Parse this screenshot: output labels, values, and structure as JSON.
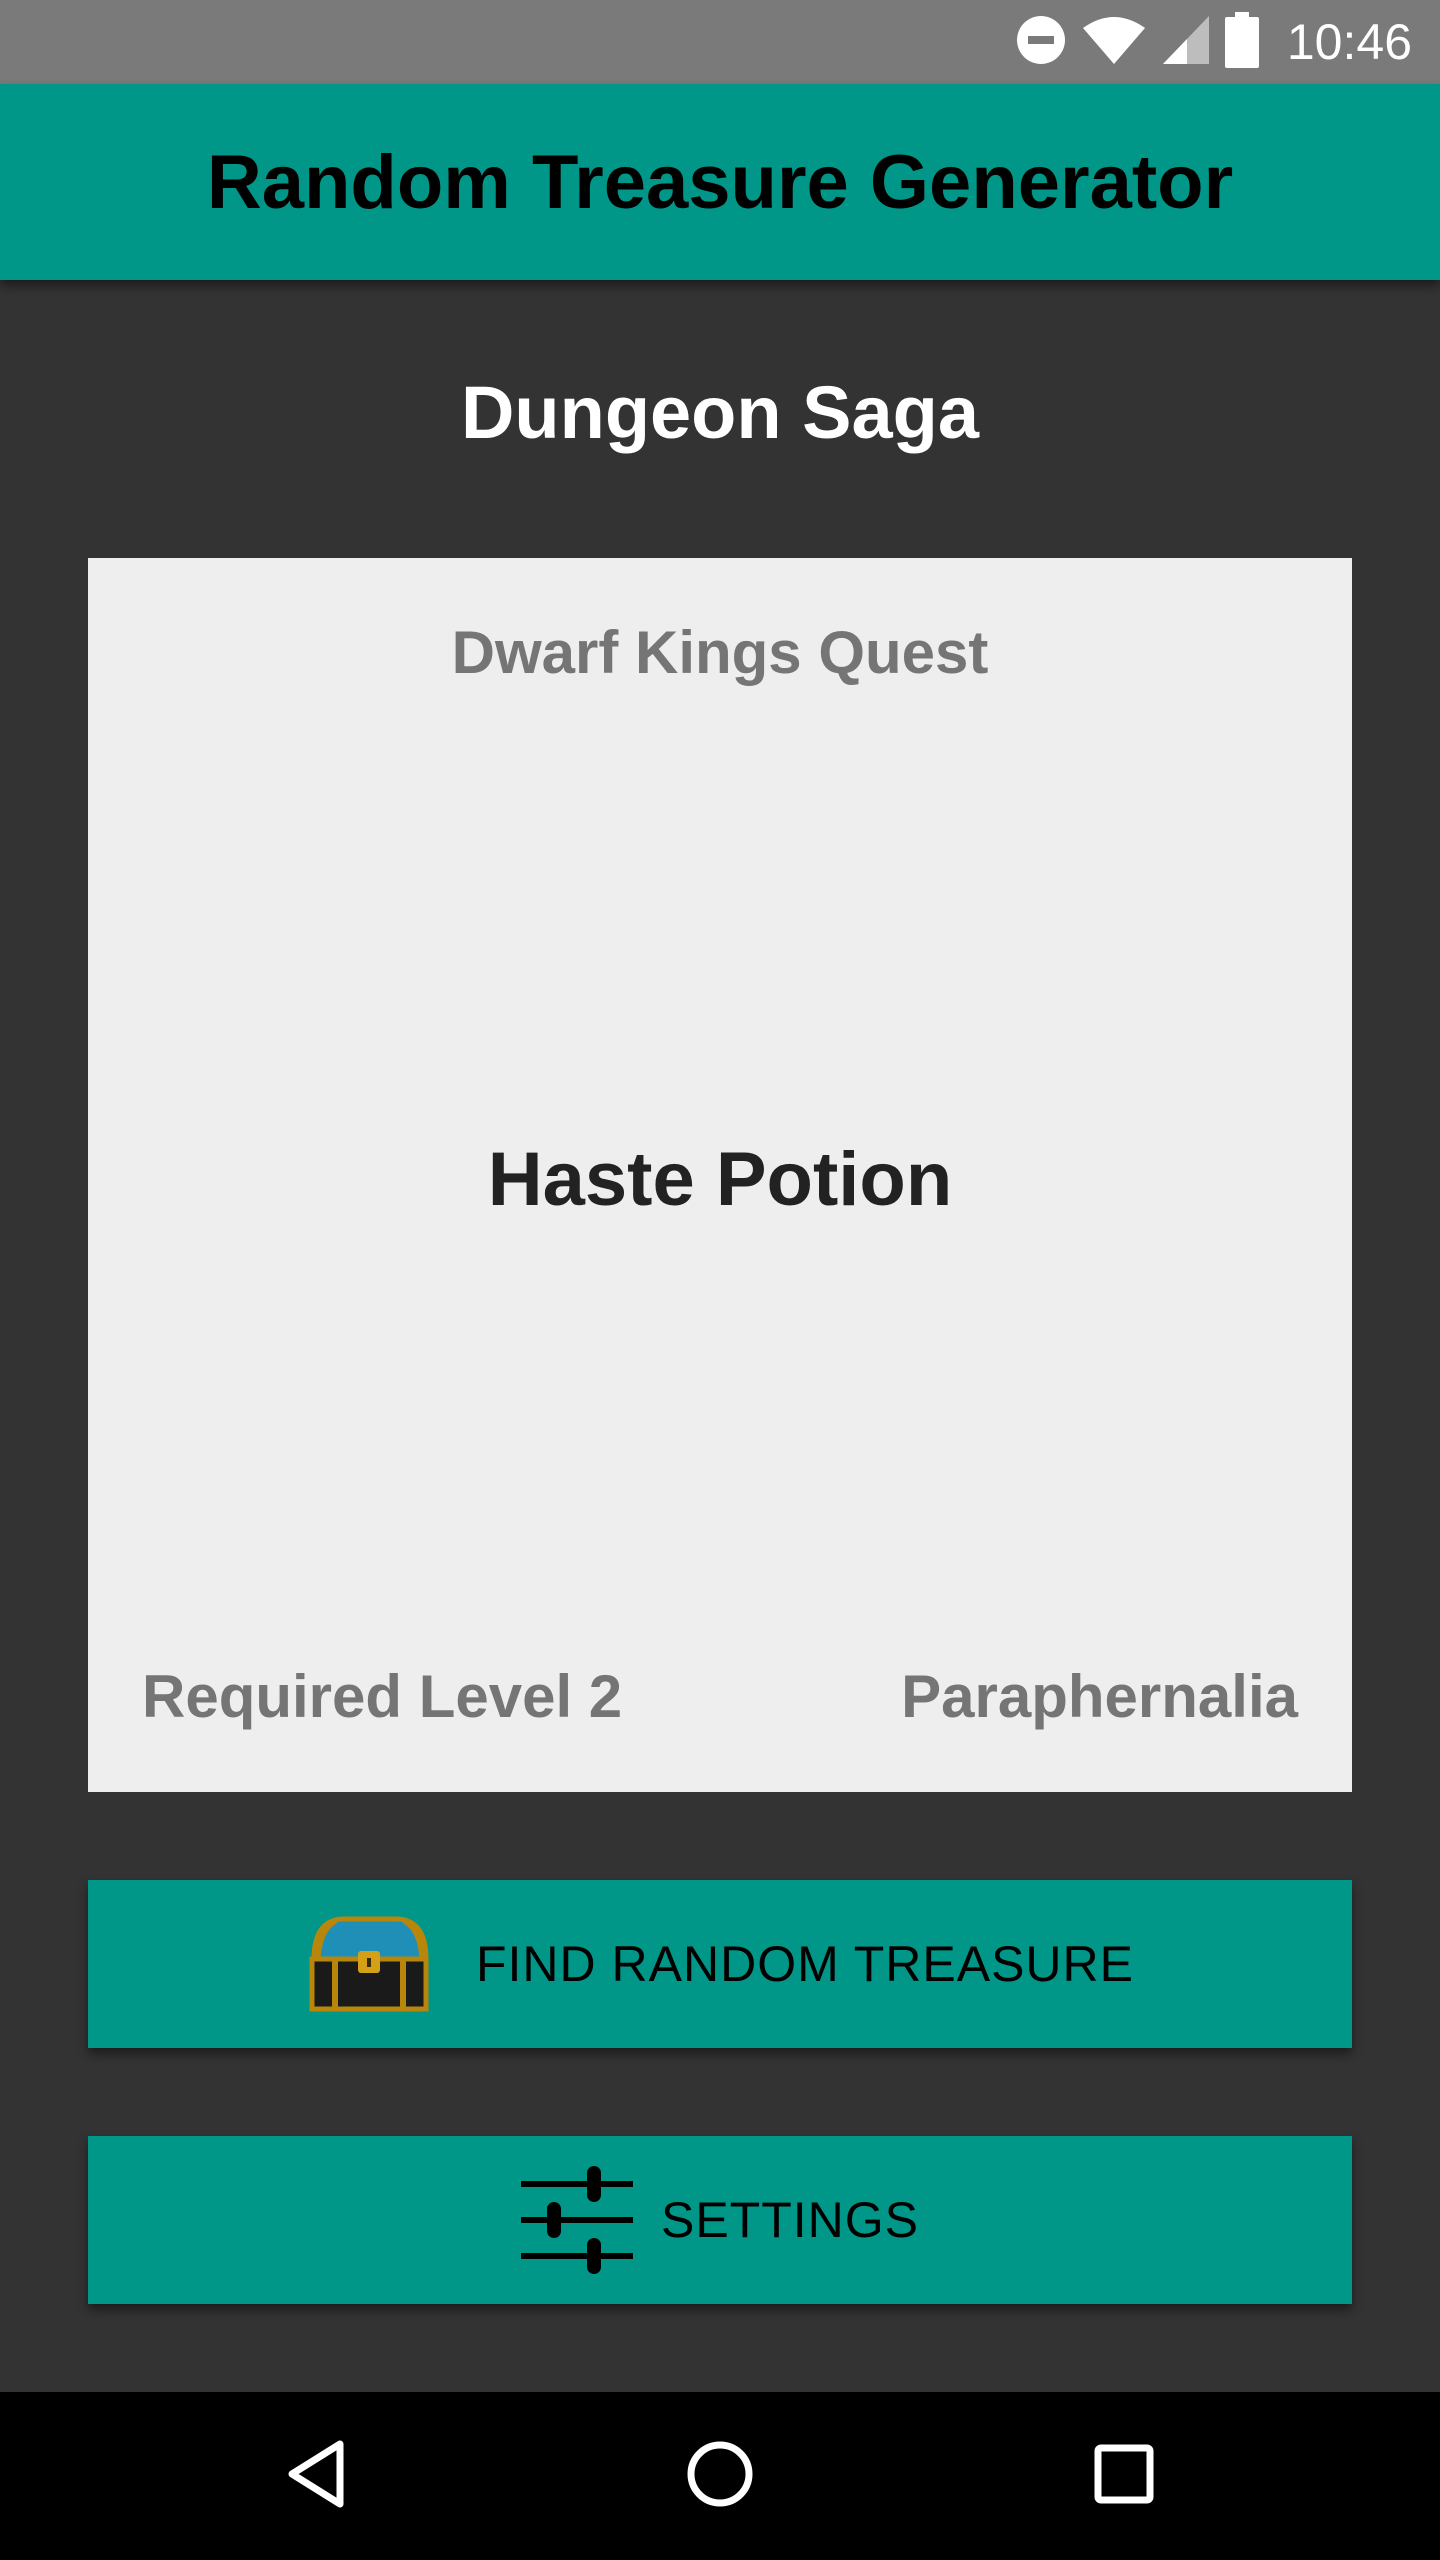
{
  "status_bar": {
    "time": "10:46",
    "icons": [
      "do-not-disturb-icon",
      "wifi-icon",
      "signal-icon",
      "battery-icon"
    ]
  },
  "app_bar": {
    "title": "Random Treasure Generator",
    "color": "#009688"
  },
  "main": {
    "game_name": "Dungeon Saga",
    "card": {
      "expansion": "Dwarf Kings Quest",
      "item_name": "Haste Potion",
      "required_level": "Required Level 2",
      "item_type": "Paraphernalia"
    },
    "buttons": {
      "find_treasure_label": "FIND RANDOM TREASURE",
      "find_treasure_icon": "treasure-chest-icon",
      "settings_label": "SETTINGS",
      "settings_icon": "sliders-icon"
    }
  },
  "nav_bar": {
    "icons": [
      "back-icon",
      "home-icon",
      "recents-icon"
    ]
  },
  "colors": {
    "accent": "#009688",
    "background": "#333333",
    "card_background": "#eeeeee",
    "status_bar": "#7a7a7a"
  }
}
